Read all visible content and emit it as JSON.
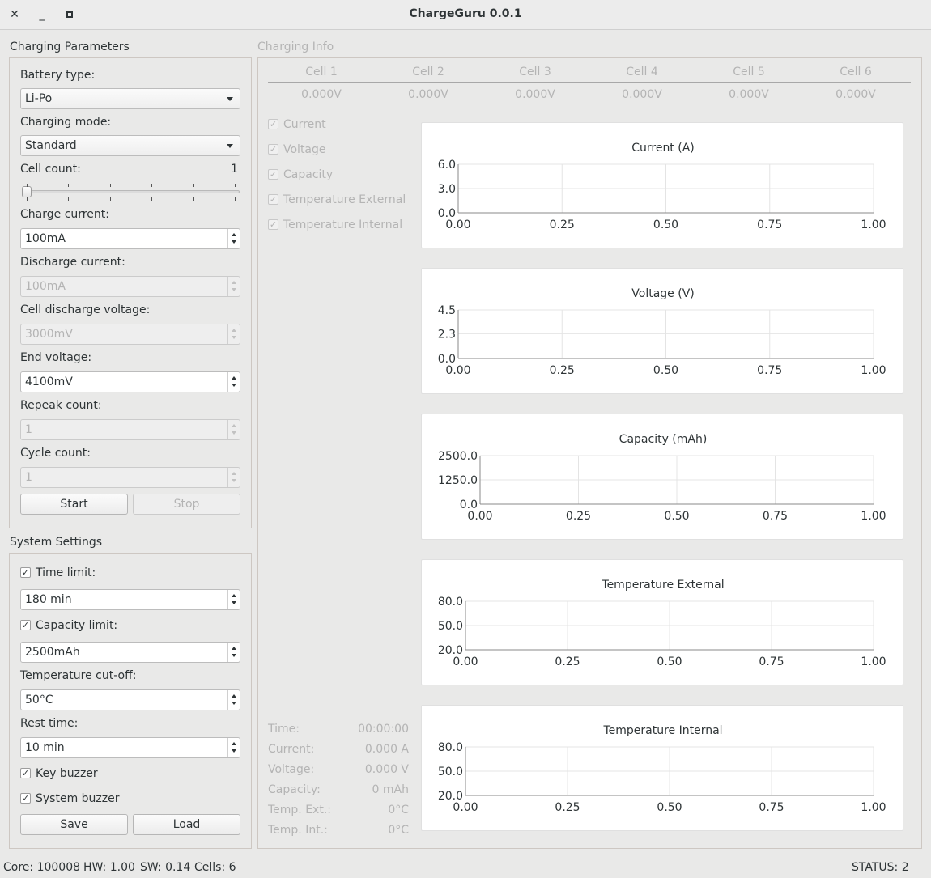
{
  "window": {
    "title": "ChargeGuru 0.0.1"
  },
  "charging_params": {
    "title": "Charging Parameters",
    "battery_type_label": "Battery type:",
    "battery_type": "Li-Po",
    "charging_mode_label": "Charging mode:",
    "charging_mode": "Standard",
    "cell_count_label": "Cell count:",
    "cell_count": "1",
    "charge_current_label": "Charge current:",
    "charge_current": "100mA",
    "discharge_current_label": "Discharge current:",
    "discharge_current": "100mA",
    "cell_discharge_voltage_label": "Cell discharge voltage:",
    "cell_discharge_voltage": "3000mV",
    "end_voltage_label": "End voltage:",
    "end_voltage": "4100mV",
    "repeak_count_label": "Repeak count:",
    "repeak_count": "1",
    "cycle_count_label": "Cycle count:",
    "cycle_count": "1",
    "start_label": "Start",
    "stop_label": "Stop"
  },
  "system_settings": {
    "title": "System Settings",
    "time_limit_label": "Time limit:",
    "time_limit": "180 min",
    "capacity_limit_label": "Capacity limit:",
    "capacity_limit": "2500mAh",
    "temp_cutoff_label": "Temperature cut-off:",
    "temp_cutoff": "50°C",
    "rest_time_label": "Rest time:",
    "rest_time": "10 min",
    "key_buzzer_label": "Key buzzer",
    "system_buzzer_label": "System buzzer",
    "save_label": "Save",
    "load_label": "Load"
  },
  "charging_info": {
    "title": "Charging Info",
    "cells": [
      {
        "name": "Cell 1",
        "voltage": "0.000V"
      },
      {
        "name": "Cell 2",
        "voltage": "0.000V"
      },
      {
        "name": "Cell 3",
        "voltage": "0.000V"
      },
      {
        "name": "Cell 4",
        "voltage": "0.000V"
      },
      {
        "name": "Cell 5",
        "voltage": "0.000V"
      },
      {
        "name": "Cell 6",
        "voltage": "0.000V"
      }
    ],
    "series_toggles": [
      "Current",
      "Voltage",
      "Capacity",
      "Temperature External",
      "Temperature Internal"
    ],
    "readouts": {
      "time_label": "Time:",
      "time": "00:00:00",
      "current_label": "Current:",
      "current": "0.000 A",
      "voltage_label": "Voltage:",
      "voltage": "0.000 V",
      "capacity_label": "Capacity:",
      "capacity": "0 mAh",
      "temp_ext_label": "Temp. Ext.:",
      "temp_ext": "0°C",
      "temp_int_label": "Temp. Int.:",
      "temp_int": "0°C"
    }
  },
  "status_bar": {
    "core": "Core: 100008",
    "hw": "HW: 1.00",
    "sw": "SW: 0.14",
    "cells": "Cells: 6",
    "status": "STATUS: 2"
  },
  "chart_data": [
    {
      "type": "line",
      "title": "Current (A)",
      "xlim": [
        0,
        1
      ],
      "ylim": [
        0,
        6
      ],
      "xticks": [
        "0.00",
        "0.25",
        "0.50",
        "0.75",
        "1.00"
      ],
      "yticks": [
        "6.0",
        "3.0",
        "0.0"
      ],
      "series": [],
      "grid": true
    },
    {
      "type": "line",
      "title": "Voltage (V)",
      "xlim": [
        0,
        1
      ],
      "ylim": [
        0,
        4.5
      ],
      "xticks": [
        "0.00",
        "0.25",
        "0.50",
        "0.75",
        "1.00"
      ],
      "yticks": [
        "4.5",
        "2.3",
        "0.0"
      ],
      "series": [],
      "grid": true
    },
    {
      "type": "line",
      "title": "Capacity (mAh)",
      "xlim": [
        0,
        1
      ],
      "ylim": [
        0,
        2500
      ],
      "xticks": [
        "0.00",
        "0.25",
        "0.50",
        "0.75",
        "1.00"
      ],
      "yticks": [
        "2500.0",
        "1250.0",
        "0.0"
      ],
      "series": [],
      "grid": true
    },
    {
      "type": "line",
      "title": "Temperature External",
      "xlim": [
        0,
        1
      ],
      "ylim": [
        20,
        80
      ],
      "xticks": [
        "0.00",
        "0.25",
        "0.50",
        "0.75",
        "1.00"
      ],
      "yticks": [
        "80.0",
        "50.0",
        "20.0"
      ],
      "series": [],
      "grid": true
    },
    {
      "type": "line",
      "title": "Temperature Internal",
      "xlim": [
        0,
        1
      ],
      "ylim": [
        20,
        80
      ],
      "xticks": [
        "0.00",
        "0.25",
        "0.50",
        "0.75",
        "1.00"
      ],
      "yticks": [
        "80.0",
        "50.0",
        "20.0"
      ],
      "series": [],
      "grid": true
    }
  ]
}
